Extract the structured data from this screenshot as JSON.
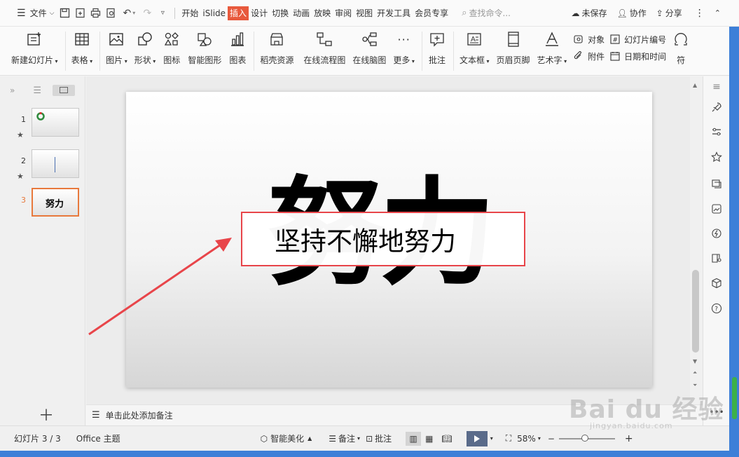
{
  "menubar": {
    "file_label": "文件",
    "tabs": [
      "开始",
      "iSlide",
      "插入",
      "设计",
      "切换",
      "动画",
      "放映",
      "审阅",
      "视图",
      "开发工具",
      "会员专享"
    ],
    "active_tab": "插入",
    "search_placeholder": "查找命令...",
    "unsaved_label": "未保存",
    "collab_label": "协作",
    "share_label": "分享"
  },
  "ribbon": {
    "new_slide": "新建幻灯片",
    "table": "表格",
    "picture": "图片",
    "shape": "形状",
    "icon": "图标",
    "smart_graphic": "智能图形",
    "chart": "图表",
    "template_resource": "稻壳资源",
    "online_flowchart": "在线流程图",
    "online_mindmap": "在线脑图",
    "more": "更多",
    "comment": "批注",
    "textbox": "文本框",
    "header_footer": "页眉页脚",
    "wordart": "艺术字",
    "object": "对象",
    "attachment": "附件",
    "slide_number": "幻灯片编号",
    "date_time": "日期和时间",
    "symbol": "符"
  },
  "slides_panel": {
    "slides": [
      {
        "number": "1",
        "starred": true
      },
      {
        "number": "2",
        "starred": true
      },
      {
        "number": "3",
        "starred": false,
        "thumb_text": "努力"
      }
    ],
    "active_index": 3
  },
  "slide": {
    "big_text": "努力",
    "box_text": "坚持不懈地努力"
  },
  "notes": {
    "placeholder": "单击此处添加备注"
  },
  "statusbar": {
    "slide_counter": "幻灯片 3 / 3",
    "theme": "Office 主题",
    "smart_beautify": "智能美化",
    "notes_label": "备注",
    "comment_label": "批注",
    "zoom": "58%"
  },
  "watermark": {
    "line1": "Bai du 经验",
    "line2": "jingyan.baidu.com"
  },
  "colors": {
    "accent": "#e8593c",
    "annotation_red": "#e8454a",
    "frame_blue": "#3d7fd8"
  }
}
